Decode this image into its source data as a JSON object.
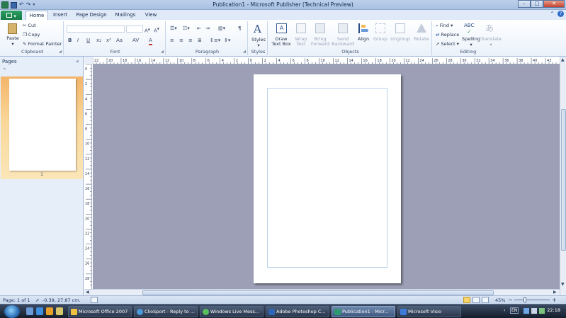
{
  "window": {
    "title": "Publication1 - Microsoft Publisher (Technical Preview)",
    "minimize_glyph": "–",
    "maximize_glyph": "□",
    "close_glyph": "✕"
  },
  "quick_access": {
    "save_icon": "save-icon",
    "undo_icon": "undo-icon",
    "redo_icon": "redo-icon"
  },
  "tabs": {
    "file_label": "",
    "items": [
      {
        "label": "Home",
        "active": true
      },
      {
        "label": "Insert",
        "active": false
      },
      {
        "label": "Page Design",
        "active": false
      },
      {
        "label": "Mailings",
        "active": false
      },
      {
        "label": "View",
        "active": false
      }
    ]
  },
  "ribbon": {
    "clipboard": {
      "label": "Clipboard",
      "paste": "Paste",
      "cut": "Cut",
      "copy": "Copy",
      "format_painter": "Format Painter"
    },
    "font": {
      "label": "Font",
      "font_name": "",
      "font_size": "",
      "bold": "B",
      "italic": "I",
      "underline": "U",
      "subscript": "x₂",
      "superscript": "x²",
      "change_case": "Aa",
      "char_spacing": "AV",
      "font_color": "A"
    },
    "paragraph": {
      "label": "Paragraph",
      "pilcrow": "¶"
    },
    "styles": {
      "label": "Styles",
      "styles": "Styles"
    },
    "objects": {
      "label": "Objects",
      "draw_text_box": "Draw Text Box",
      "wrap_text": "Wrap Text",
      "bring_forward": "Bring Forward",
      "send_backward": "Send Backward",
      "align": "Align",
      "group": "Group",
      "ungroup": "Ungroup",
      "rotate": "Rotate"
    },
    "editing": {
      "label": "Editing",
      "find": "Find",
      "replace": "Replace",
      "select": "Select",
      "spelling": "Spelling",
      "translate": "Translate"
    }
  },
  "pages_pane": {
    "title": "Pages",
    "collapse_glyph": "«",
    "scroll_up_glyph": "«",
    "thumbnail_number": "1"
  },
  "ruler": {
    "horizontal_labels": [
      "22",
      "20",
      "18",
      "16",
      "14",
      "12",
      "10",
      "8",
      "6",
      "4",
      "2",
      "0",
      "2",
      "4",
      "6",
      "8",
      "10",
      "12",
      "14",
      "16",
      "18",
      "20",
      "22",
      "24",
      "26",
      "28",
      "30",
      "32",
      "34",
      "36",
      "38",
      "40",
      "42"
    ],
    "vertical_labels": [
      "0",
      "2",
      "4",
      "6",
      "8",
      "10",
      "12",
      "14",
      "16",
      "18",
      "20",
      "22",
      "24",
      "26",
      "28"
    ]
  },
  "status": {
    "page": "Page: 1 of 1",
    "position": "-0.39, 27.87 cm.",
    "zoom": "45%",
    "zoom_out": "−",
    "zoom_in": "+"
  },
  "taskbar": {
    "tasks": [
      {
        "label": "Microsoft Office 2007",
        "color": "#f0c040",
        "active": false
      },
      {
        "label": "ClioSport - Reply to ...",
        "color": "#4a9ad8",
        "active": false
      },
      {
        "label": "Windows Live Mess...",
        "color": "#5bbf5b",
        "active": false
      },
      {
        "label": "Adobe Photoshop C...",
        "color": "#2d66b5",
        "active": false
      },
      {
        "label": "Publication1 - Micr...",
        "color": "#2f9b72",
        "active": true
      },
      {
        "label": "Microsoft Visio",
        "color": "#3d7bd6",
        "active": false
      }
    ],
    "language": "EN",
    "clock": "22:18"
  }
}
